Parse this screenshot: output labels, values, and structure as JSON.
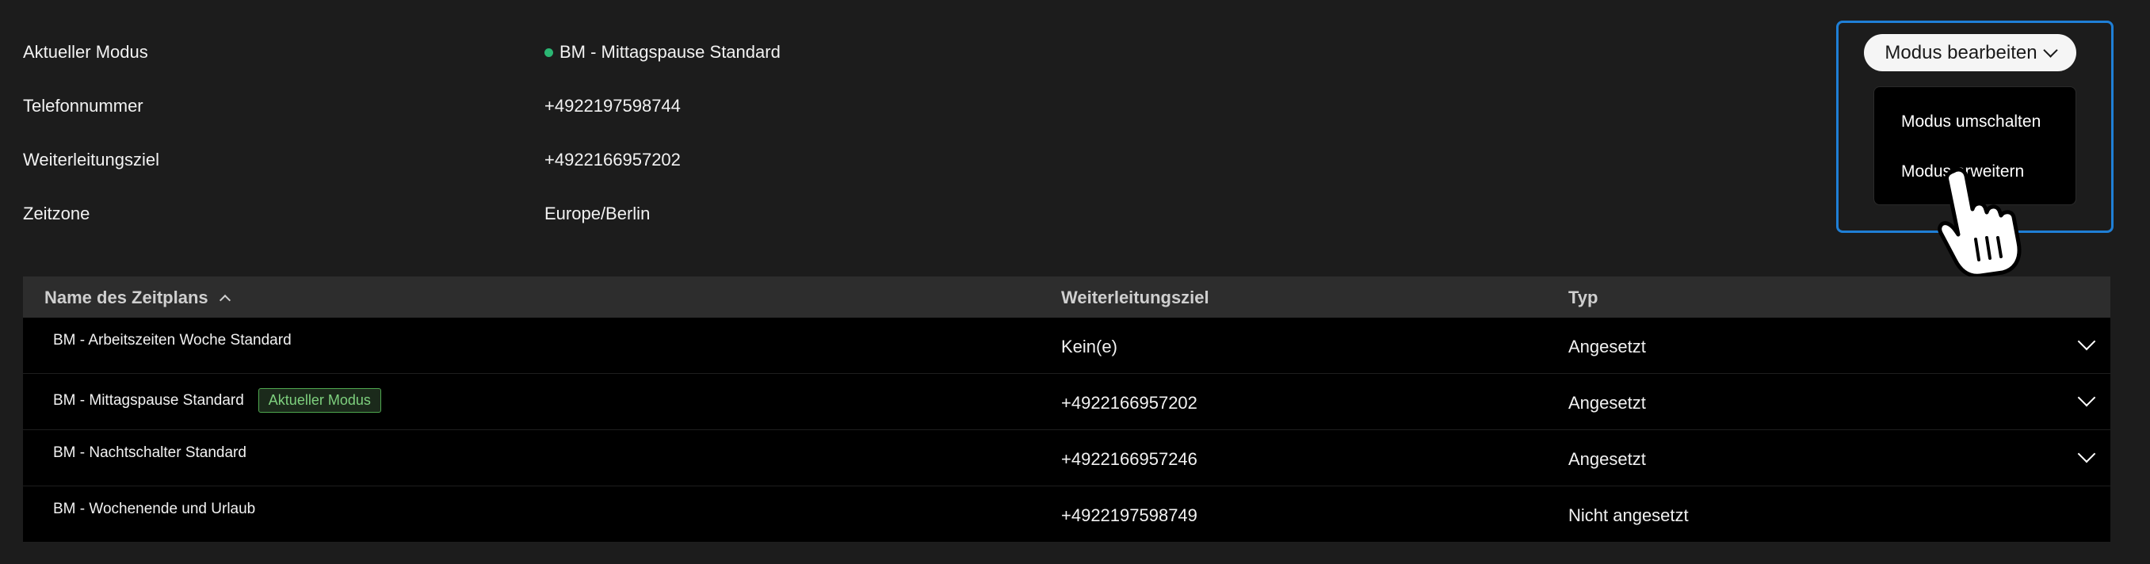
{
  "info": {
    "current_mode_label": "Aktueller Modus",
    "current_mode_value": "BM - Mittagspause Standard",
    "phone_label": "Telefonnummer",
    "phone_value": "+4922197598744",
    "forward_label": "Weiterleitungsziel",
    "forward_value": "+4922166957202",
    "timezone_label": "Zeitzone",
    "timezone_value": "Europe/Berlin"
  },
  "mode_menu": {
    "button_label": "Modus bearbeiten",
    "items": [
      "Modus umschalten",
      "Modus erweitern"
    ]
  },
  "table": {
    "headers": [
      "Name des Zeitplans",
      "Weiterleitungsziel",
      "Typ"
    ],
    "rows": [
      {
        "name": "BM - Arbeitszeiten Woche Standard",
        "target": "Kein(e)",
        "type": "Angesetzt",
        "badge": ""
      },
      {
        "name": "BM - Mittagspause Standard",
        "target": "+4922166957202",
        "type": "Angesetzt",
        "badge": "Aktueller Modus"
      },
      {
        "name": "BM - Nachtschalter Standard",
        "target": "+4922166957246",
        "type": "Angesetzt",
        "badge": ""
      },
      {
        "name": "BM - Wochenende und Urlaub",
        "target": "+4922197598749",
        "type": "Nicht angesetzt",
        "badge": ""
      }
    ]
  },
  "colors": {
    "background": "#1c1c1c",
    "focus_border": "#1f7fd6",
    "status_green": "#2bb673",
    "badge_green": "#7ed07e"
  },
  "icons": {
    "status": "status-dot-icon",
    "dropdown": "chevron-down-icon",
    "sort": "sort-ascending-icon",
    "expand": "chevron-down-icon",
    "cursor": "hand-pointer-icon"
  }
}
